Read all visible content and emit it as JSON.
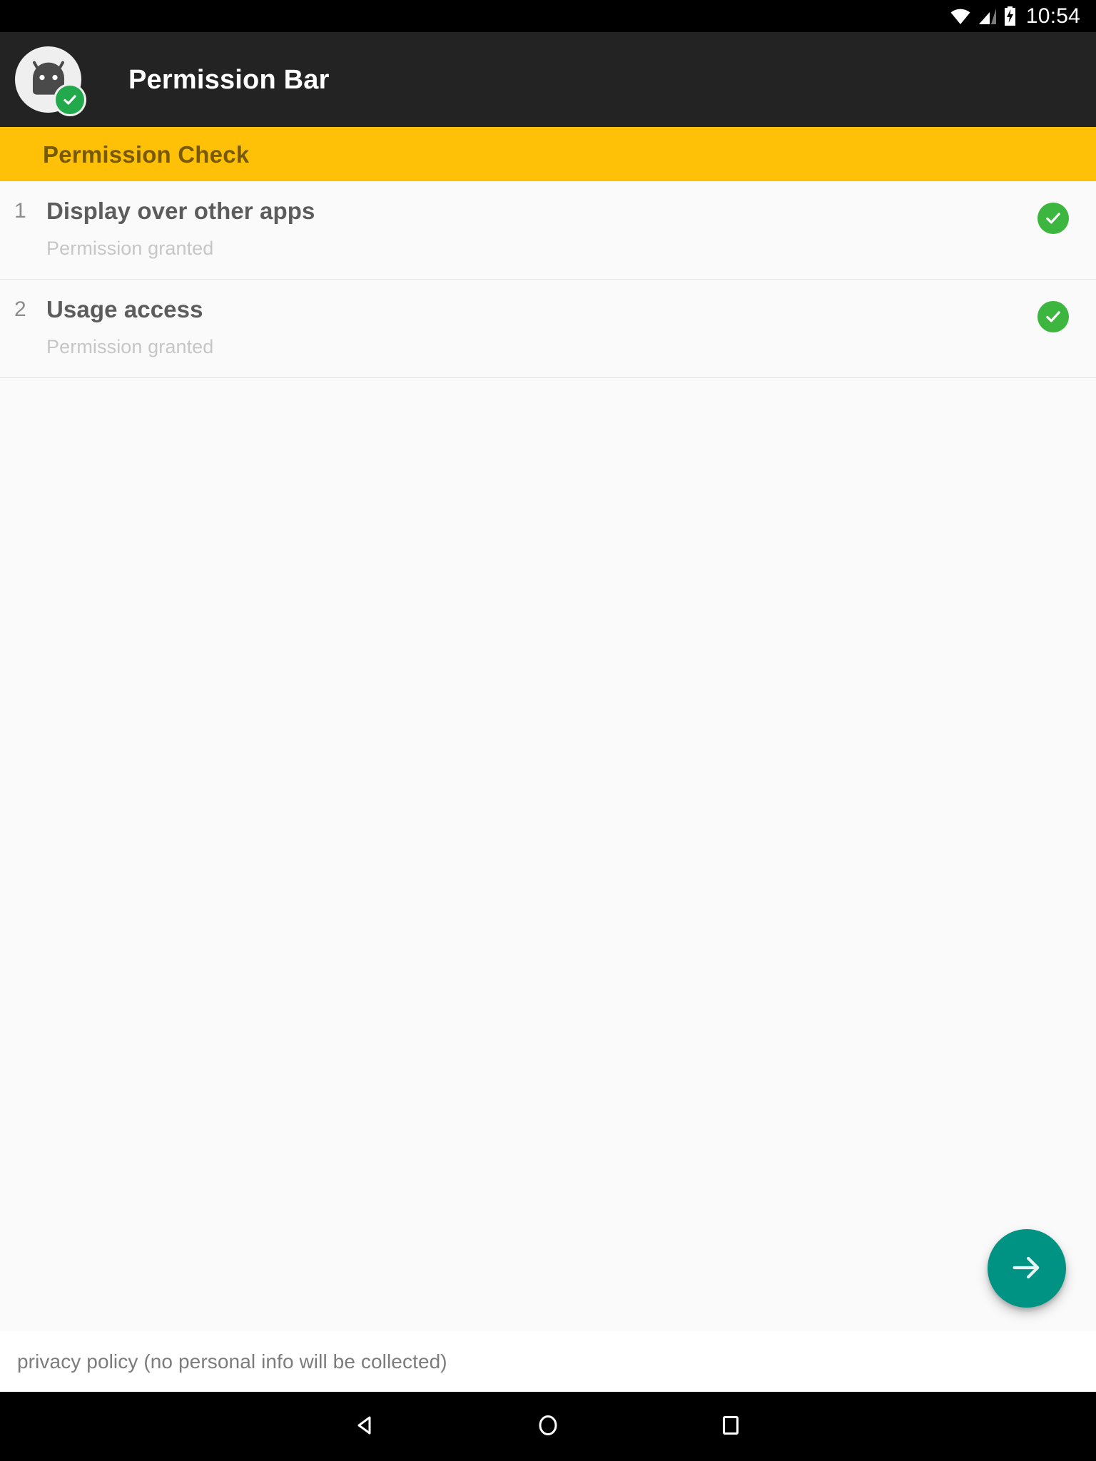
{
  "status_bar": {
    "time": "10:54",
    "icons": [
      {
        "name": "wifi-icon"
      },
      {
        "name": "cellular-signal-icon"
      },
      {
        "name": "battery-charging-icon"
      }
    ]
  },
  "toolbar": {
    "title": "Permission Bar",
    "app_icon_name": "android-app-icon",
    "badge_icon_name": "check-badge-icon",
    "background_color": "#232323"
  },
  "section_header": {
    "title": "Permission Check",
    "background_color": "#FEC107",
    "text_color": "#775A07"
  },
  "permissions": [
    {
      "index": "1",
      "title": "Display over other apps",
      "subtitle": "Permission granted",
      "status_icon": "check-circle-icon",
      "status_color": "#3DB63F"
    },
    {
      "index": "2",
      "title": "Usage access",
      "subtitle": "Permission granted",
      "status_icon": "check-circle-icon",
      "status_color": "#3DB63F"
    }
  ],
  "fab": {
    "icon_name": "arrow-right-icon",
    "color": "#009383"
  },
  "footer": {
    "privacy_policy": "privacy policy (no personal info will be collected)"
  },
  "nav_bar": {
    "back_label": "back-icon",
    "home_label": "home-icon",
    "recents_label": "recents-icon"
  }
}
